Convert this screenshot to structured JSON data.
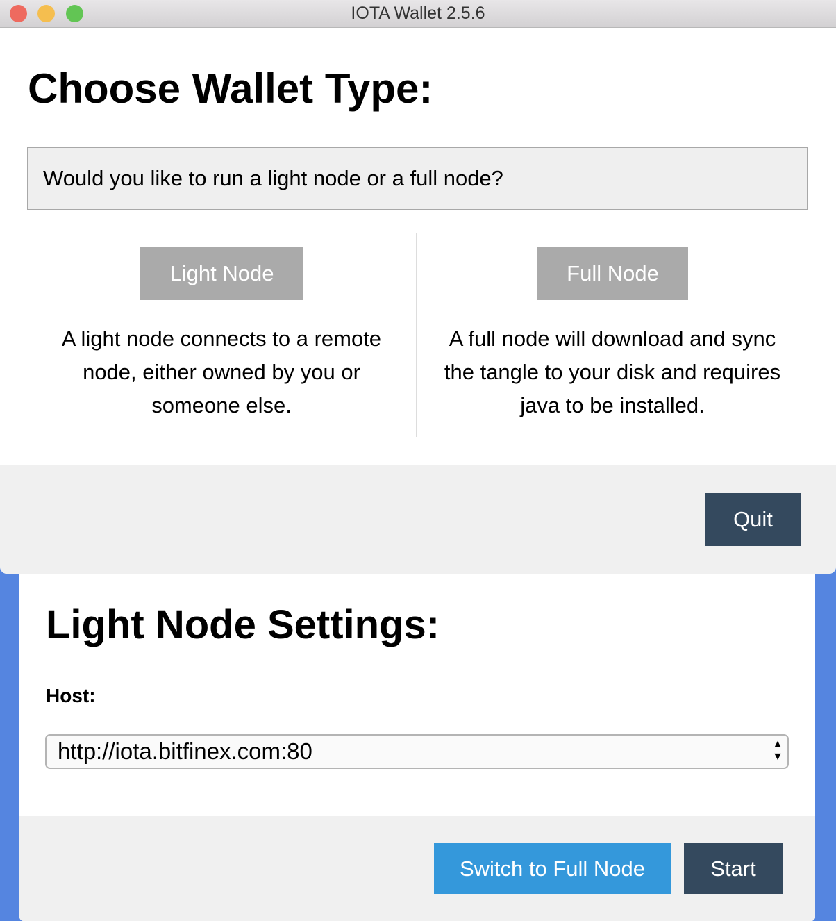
{
  "window": {
    "title": "IOTA Wallet 2.5.6",
    "controls": {
      "close": "#ee6a5f",
      "minimize": "#f5be4f",
      "zoom": "#62c554"
    }
  },
  "wallet_type": {
    "heading": "Choose Wallet Type:",
    "question": "Would you like to run a light node or a full node?",
    "light": {
      "button": "Light Node",
      "description": "A light node connects to a remote node, either owned by you or someone else."
    },
    "full": {
      "button": "Full Node",
      "description": "A full node will download and sync the tangle to your disk and requires java to be installed."
    },
    "quit_label": "Quit"
  },
  "light_settings": {
    "heading": "Light Node Settings:",
    "host_label": "Host:",
    "host_value": "http://iota.bitfinex.com:80",
    "switch_label": "Switch to Full Node",
    "start_label": "Start"
  },
  "colors": {
    "dark_button": "#34495e",
    "blue_button": "#3498db",
    "background": "#5585e0"
  }
}
